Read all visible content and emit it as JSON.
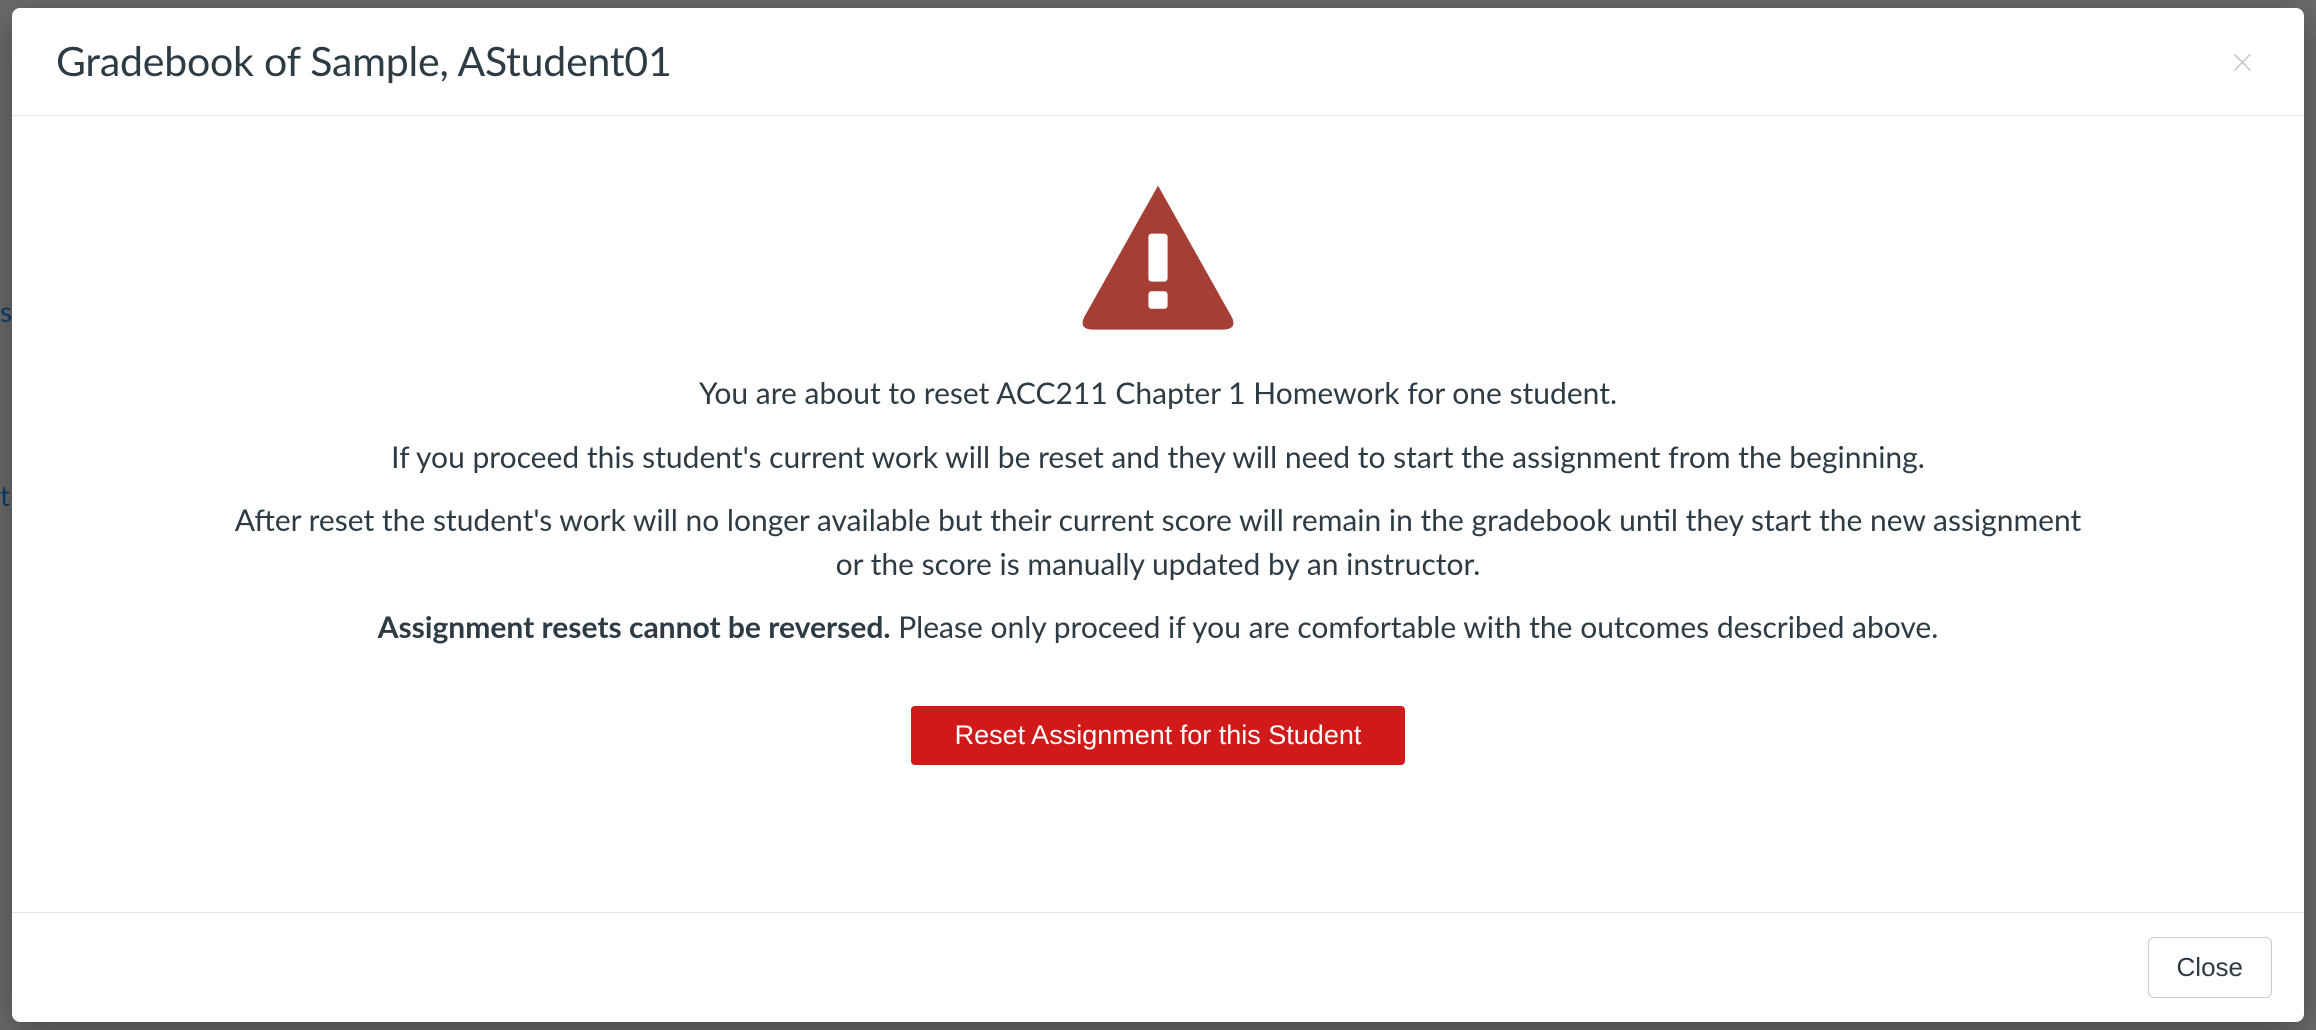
{
  "background": {
    "snippet1": "s",
    "snippet2": "t"
  },
  "modal": {
    "title": "Gradebook of Sample, AStudent01",
    "close_x_label": "×",
    "body": {
      "line1": "You are about to reset ACC211 Chapter 1 Homework for one student.",
      "line2": "If you proceed this student's current work will be reset and they will need to start the assignment from the beginning.",
      "line3": "After reset the student's work will no longer available but their current score will remain in the gradebook until they start the new assignment or the score is manually updated by an instructor.",
      "line4_bold": "Assignment resets cannot be reversed.",
      "line4_rest": " Please only proceed if you are comfortable with the outcomes described above."
    },
    "reset_button_label": "Reset Assignment for this Student",
    "footer": {
      "close_label": "Close"
    }
  },
  "colors": {
    "warn_icon": "#a53e35",
    "danger_button": "#d01a19"
  }
}
